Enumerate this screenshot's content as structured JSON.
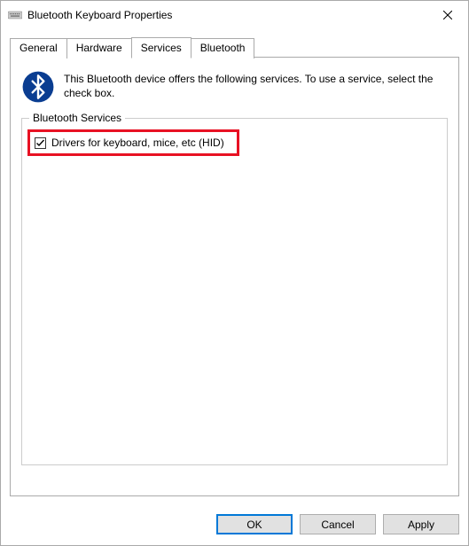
{
  "window": {
    "title": "Bluetooth Keyboard Properties"
  },
  "tabs": {
    "general": "General",
    "hardware": "Hardware",
    "services": "Services",
    "bluetooth": "Bluetooth"
  },
  "services": {
    "info_text": "This Bluetooth device offers the following services. To use a service, select the check box.",
    "group_label": "Bluetooth Services",
    "items": [
      {
        "label": "Drivers for keyboard, mice, etc (HID)",
        "checked": true
      }
    ]
  },
  "buttons": {
    "ok": "OK",
    "cancel": "Cancel",
    "apply": "Apply"
  }
}
